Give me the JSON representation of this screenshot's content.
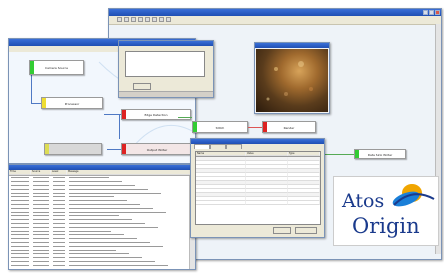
{
  "back_window": {
    "title": "",
    "toolbar_icons": [
      "save-icon",
      "cut-icon",
      "copy-icon",
      "paste-icon",
      "undo-icon",
      "redo-icon",
      "zoom-icon",
      "grid-icon"
    ],
    "right_node": {
      "label": "Data Sink Writer"
    }
  },
  "main_window": {
    "title": "",
    "nodes": [
      {
        "id": "n1",
        "label": "Camera Source",
        "tab_color": "#33cc33"
      },
      {
        "id": "n2",
        "label": "Processor",
        "tab_color": "#eedd33"
      },
      {
        "id": "n3",
        "label": "Edge Detection",
        "tab_color": "#dd2222"
      },
      {
        "id": "n4",
        "label": "",
        "tab_color": "#cccccc"
      },
      {
        "id": "n5",
        "label": "Output Writer",
        "tab_color": "#dd2222"
      },
      {
        "id": "n6",
        "label": "Stitch",
        "tab_color": "#33cc33"
      },
      {
        "id": "n7",
        "label": "Render",
        "tab_color": "#dd2222"
      }
    ]
  },
  "dialog": {
    "title": "",
    "lines": [
      "",
      "",
      "",
      ""
    ],
    "ok_label": ""
  },
  "properties": {
    "title": "",
    "tabs": [
      "",
      "",
      ""
    ],
    "columns": [
      "Name",
      "Value",
      "Type"
    ],
    "rows": [
      [
        "",
        "",
        ""
      ],
      [
        "",
        "",
        ""
      ],
      [
        "",
        "",
        ""
      ],
      [
        "",
        "",
        ""
      ],
      [
        "",
        "",
        ""
      ],
      [
        "",
        "",
        ""
      ],
      [
        "",
        "",
        ""
      ],
      [
        "",
        "",
        ""
      ],
      [
        "",
        "",
        ""
      ],
      [
        "",
        "",
        ""
      ],
      [
        "",
        "",
        ""
      ],
      [
        "",
        "",
        ""
      ]
    ],
    "ok_label": "",
    "cancel_label": ""
  },
  "log": {
    "title": "",
    "columns": [
      "Time",
      "Source",
      "Level",
      "Message"
    ],
    "row_count_visible": 24
  },
  "preview": {
    "title": ""
  },
  "logo": {
    "line1": "Atos",
    "line2": "Origin",
    "accent": "#1a3a8c",
    "swoosh": "#f0a500"
  }
}
